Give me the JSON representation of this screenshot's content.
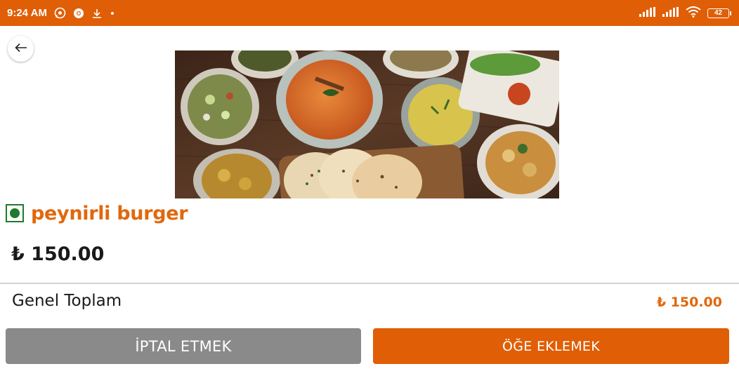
{
  "status_bar": {
    "time": "9:24 AM",
    "battery": "42",
    "icons": [
      "whatsapp-icon",
      "chrome-icon",
      "download-icon",
      "dot-icon",
      "signal-icon",
      "signal-icon",
      "wifi-icon",
      "battery-icon"
    ]
  },
  "nav": {
    "back_icon": "arrow-left-icon"
  },
  "item": {
    "name": "peynirli burger",
    "price": "₺ 150.00",
    "veg_indicator": "veg-icon"
  },
  "summary": {
    "total_label": "Genel Toplam",
    "total_value": "₺ 150.00"
  },
  "actions": {
    "cancel_label": "İPTAL ETMEK",
    "add_label": "ÖĞE EKLEMEK"
  },
  "colors": {
    "accent": "#e05e06",
    "cancel": "#8a8a8a",
    "veg": "#1f7a2e"
  }
}
